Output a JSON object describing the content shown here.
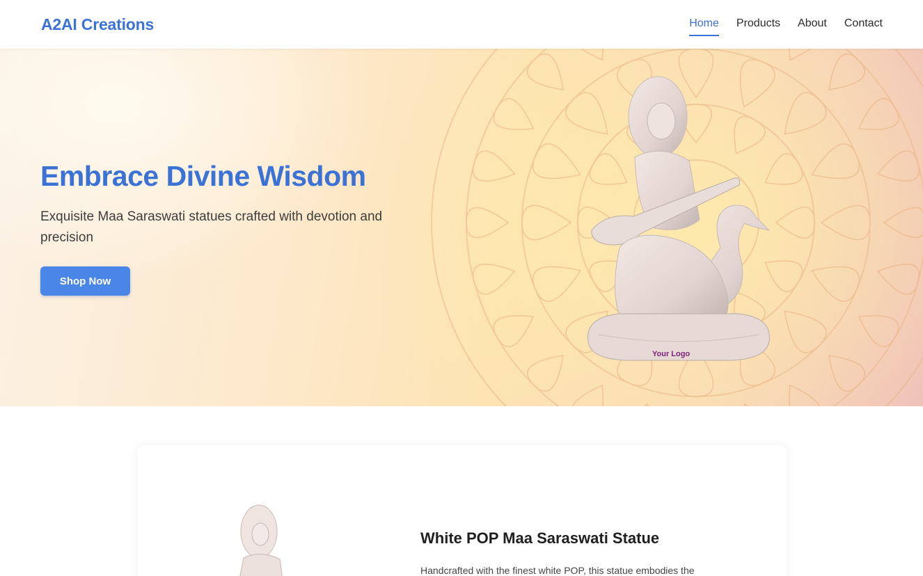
{
  "header": {
    "brand": "A2AI Creations",
    "nav": [
      {
        "label": "Home",
        "active": true
      },
      {
        "label": "Products",
        "active": false
      },
      {
        "label": "About",
        "active": false
      },
      {
        "label": "Contact",
        "active": false
      }
    ]
  },
  "hero": {
    "title": "Embrace Divine Wisdom",
    "subtitle": "Exquisite Maa Saraswati statues crafted with devotion and precision",
    "cta_label": "Shop Now",
    "image_logo_text": "Your Logo"
  },
  "product": {
    "title": "White POP Maa Saraswati Statue",
    "description": "Handcrafted with the finest white POP, this statue embodies the"
  },
  "colors": {
    "accent": "#3a72d6",
    "button": "#4a86e8"
  }
}
